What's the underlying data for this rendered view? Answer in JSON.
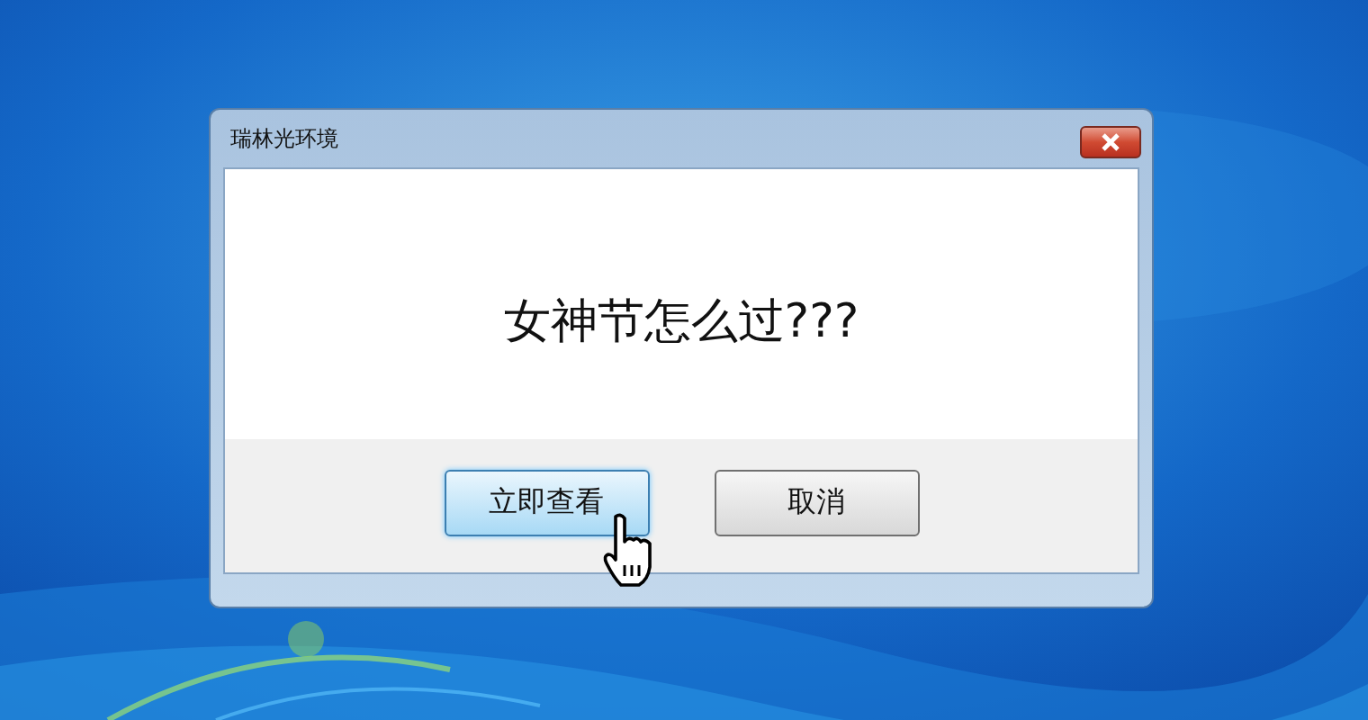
{
  "window": {
    "title": "瑞林光环境"
  },
  "message": "女神节怎么过???",
  "buttons": [
    {
      "label": "立即查看",
      "focused": true
    },
    {
      "label": "取消",
      "focused": false
    }
  ]
}
